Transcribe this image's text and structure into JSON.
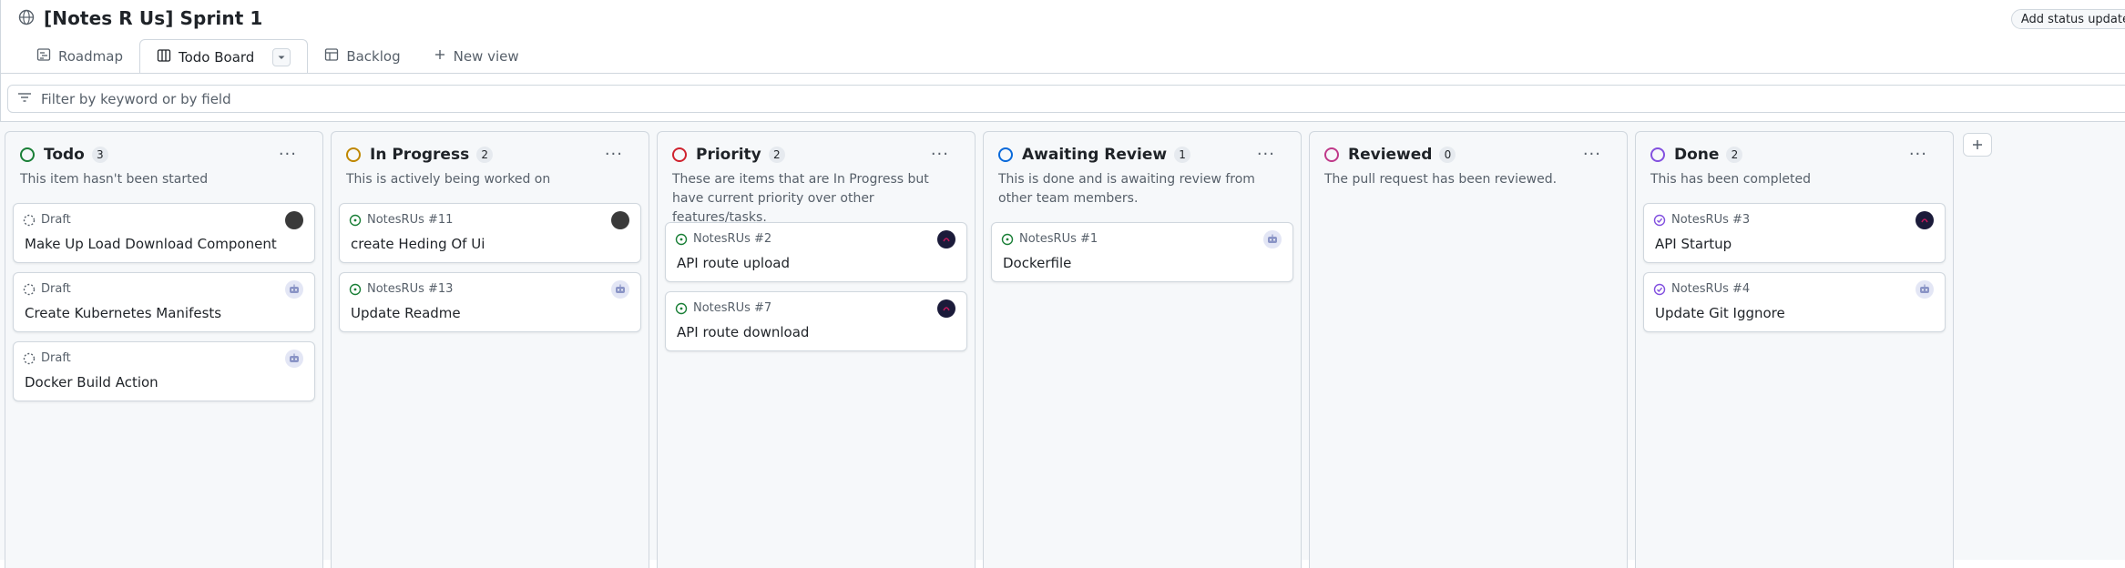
{
  "header": {
    "title": "[Notes R Us] Sprint 1",
    "status_button": "Add status update"
  },
  "tabs": [
    {
      "label": "Roadmap",
      "icon": "roadmap-icon"
    },
    {
      "label": "Todo Board",
      "icon": "board-icon",
      "active": true
    },
    {
      "label": "Backlog",
      "icon": "table-icon"
    },
    {
      "label": "New view",
      "icon": "plus-icon"
    }
  ],
  "filter": {
    "placeholder": "Filter by keyword or by field"
  },
  "colors": {
    "todo": "#1a7f37",
    "in_progress": "#bf8700",
    "priority": "#cf222e",
    "awaiting_review": "#0969da",
    "reviewed": "#bf3989",
    "done": "#8250df",
    "open_issue": "#1a7f37",
    "closed_issue": "#8250df"
  },
  "columns": [
    {
      "name": "Todo",
      "count": "3",
      "description": "This item hasn't been started",
      "cards": [
        {
          "type": "draft",
          "meta": "Draft",
          "title": "Make Up Load Download Component",
          "avatar": "dark"
        },
        {
          "type": "draft",
          "meta": "Draft",
          "title": "Create Kubernetes Manifests",
          "avatar": "bot"
        },
        {
          "type": "draft",
          "meta": "Draft",
          "title": "Docker Build Action",
          "avatar": "bot"
        }
      ]
    },
    {
      "name": "In Progress",
      "count": "2",
      "description": "This is actively being worked on",
      "cards": [
        {
          "type": "open",
          "meta": "NotesRUs #11",
          "title": "create Heding Of Ui",
          "avatar": "dark"
        },
        {
          "type": "open",
          "meta": "NotesRUs #13",
          "title": "Update Readme",
          "avatar": "bot"
        }
      ]
    },
    {
      "name": "Priority",
      "count": "2",
      "description": "These are items that are In Progress but have current priority over other features/tasks.",
      "cards": [
        {
          "type": "open",
          "meta": "NotesRUs #2",
          "title": "API route upload",
          "avatar": "navy"
        },
        {
          "type": "open",
          "meta": "NotesRUs #7",
          "title": "API route download",
          "avatar": "navy"
        }
      ]
    },
    {
      "name": "Awaiting Review",
      "count": "1",
      "description": "This is done and is awaiting review from other team members.",
      "cards": [
        {
          "type": "open",
          "meta": "NotesRUs #1",
          "title": "Dockerfile",
          "avatar": "bot"
        }
      ]
    },
    {
      "name": "Reviewed",
      "count": "0",
      "description": "The pull request has been reviewed.",
      "cards": []
    },
    {
      "name": "Done",
      "count": "2",
      "description": "This has been completed",
      "cards": [
        {
          "type": "closed",
          "meta": "NotesRUs #3",
          "title": "API Startup",
          "avatar": "navy"
        },
        {
          "type": "closed",
          "meta": "NotesRUs #4",
          "title": "Update Git Iggnore",
          "avatar": "bot"
        }
      ]
    }
  ]
}
